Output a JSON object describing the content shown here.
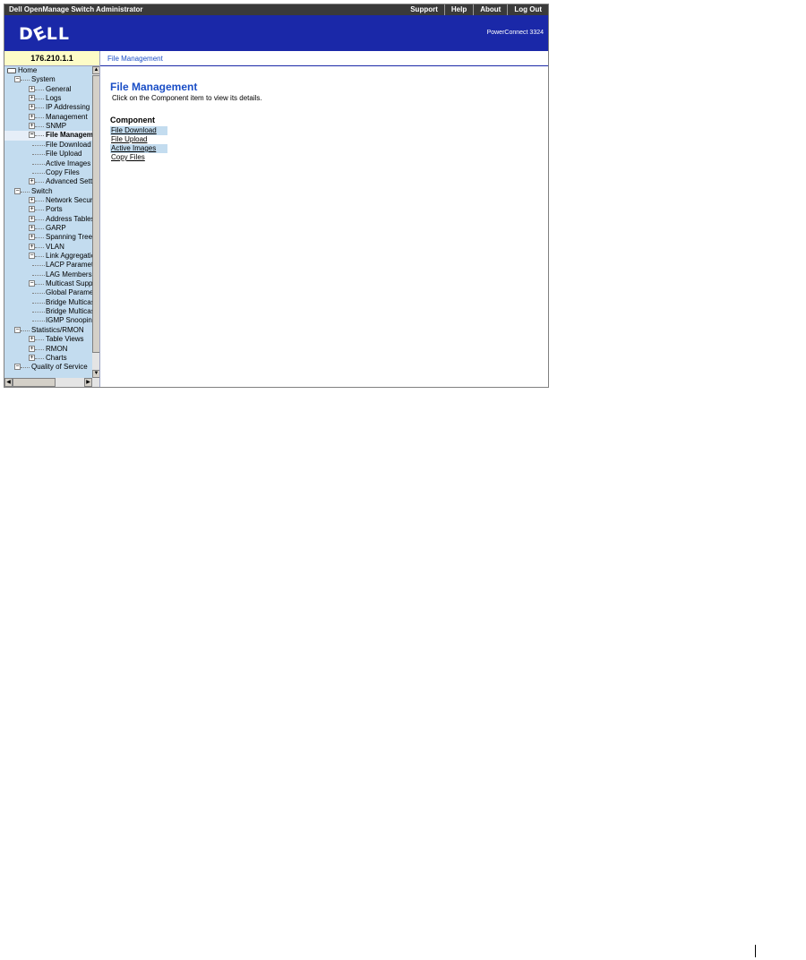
{
  "window": {
    "title": "Dell OpenManage Switch Administrator"
  },
  "topnav": [
    "Support",
    "Help",
    "About",
    "Log Out"
  ],
  "banner": {
    "logo": "DELL",
    "product": "PowerConnect 3324"
  },
  "device": {
    "ip": "176.210.1.1"
  },
  "breadcrumb": "File Management",
  "tree": [
    {
      "label": "Home",
      "level": 0,
      "expander": "folder"
    },
    {
      "label": "System",
      "level": 1,
      "expander": "-"
    },
    {
      "label": "General",
      "level": 2,
      "expander": "+"
    },
    {
      "label": "Logs",
      "level": 2,
      "expander": "+"
    },
    {
      "label": "IP Addressing",
      "level": 2,
      "expander": "+"
    },
    {
      "label": "Management",
      "level": 2,
      "expander": "+"
    },
    {
      "label": "SNMP",
      "level": 2,
      "expander": "+"
    },
    {
      "label": "File Management",
      "level": 2,
      "expander": "-",
      "selected": true
    },
    {
      "label": "File Download",
      "level": 3,
      "expander": ""
    },
    {
      "label": "File Upload",
      "level": 3,
      "expander": ""
    },
    {
      "label": "Active Images",
      "level": 3,
      "expander": ""
    },
    {
      "label": "Copy Files",
      "level": 3,
      "expander": ""
    },
    {
      "label": "Advanced Settings",
      "level": 2,
      "expander": "+"
    },
    {
      "label": "Switch",
      "level": 1,
      "expander": "-"
    },
    {
      "label": "Network Security",
      "level": 2,
      "expander": "+"
    },
    {
      "label": "Ports",
      "level": 2,
      "expander": "+"
    },
    {
      "label": "Address Tables",
      "level": 2,
      "expander": "+"
    },
    {
      "label": "GARP",
      "level": 2,
      "expander": "+"
    },
    {
      "label": "Spanning Tree",
      "level": 2,
      "expander": "+"
    },
    {
      "label": "VLAN",
      "level": 2,
      "expander": "+"
    },
    {
      "label": "Link Aggregation",
      "level": 2,
      "expander": "-"
    },
    {
      "label": "LACP Parameters",
      "level": 3,
      "expander": ""
    },
    {
      "label": "LAG Membership",
      "level": 3,
      "expander": ""
    },
    {
      "label": "Multicast Support",
      "level": 2,
      "expander": "-"
    },
    {
      "label": "Global Parameters",
      "level": 3,
      "expander": ""
    },
    {
      "label": "Bridge Multicast",
      "level": 3,
      "expander": ""
    },
    {
      "label": "Bridge Multicast",
      "level": 3,
      "expander": ""
    },
    {
      "label": "IGMP Snooping",
      "level": 3,
      "expander": ""
    },
    {
      "label": "Statistics/RMON",
      "level": 1,
      "expander": "-"
    },
    {
      "label": "Table Views",
      "level": 2,
      "expander": "+"
    },
    {
      "label": "RMON",
      "level": 2,
      "expander": "+"
    },
    {
      "label": "Charts",
      "level": 2,
      "expander": "+"
    },
    {
      "label": "Quality of Service",
      "level": 1,
      "expander": "-"
    }
  ],
  "main": {
    "title": "File Management",
    "description": "Click on the Component item to view its details.",
    "section_heading": "Component",
    "links": [
      {
        "label": "File Download",
        "highlight": true
      },
      {
        "label": "File Upload",
        "highlight": false
      },
      {
        "label": "Active Images",
        "highlight": true
      },
      {
        "label": "Copy Files",
        "highlight": false
      }
    ]
  }
}
